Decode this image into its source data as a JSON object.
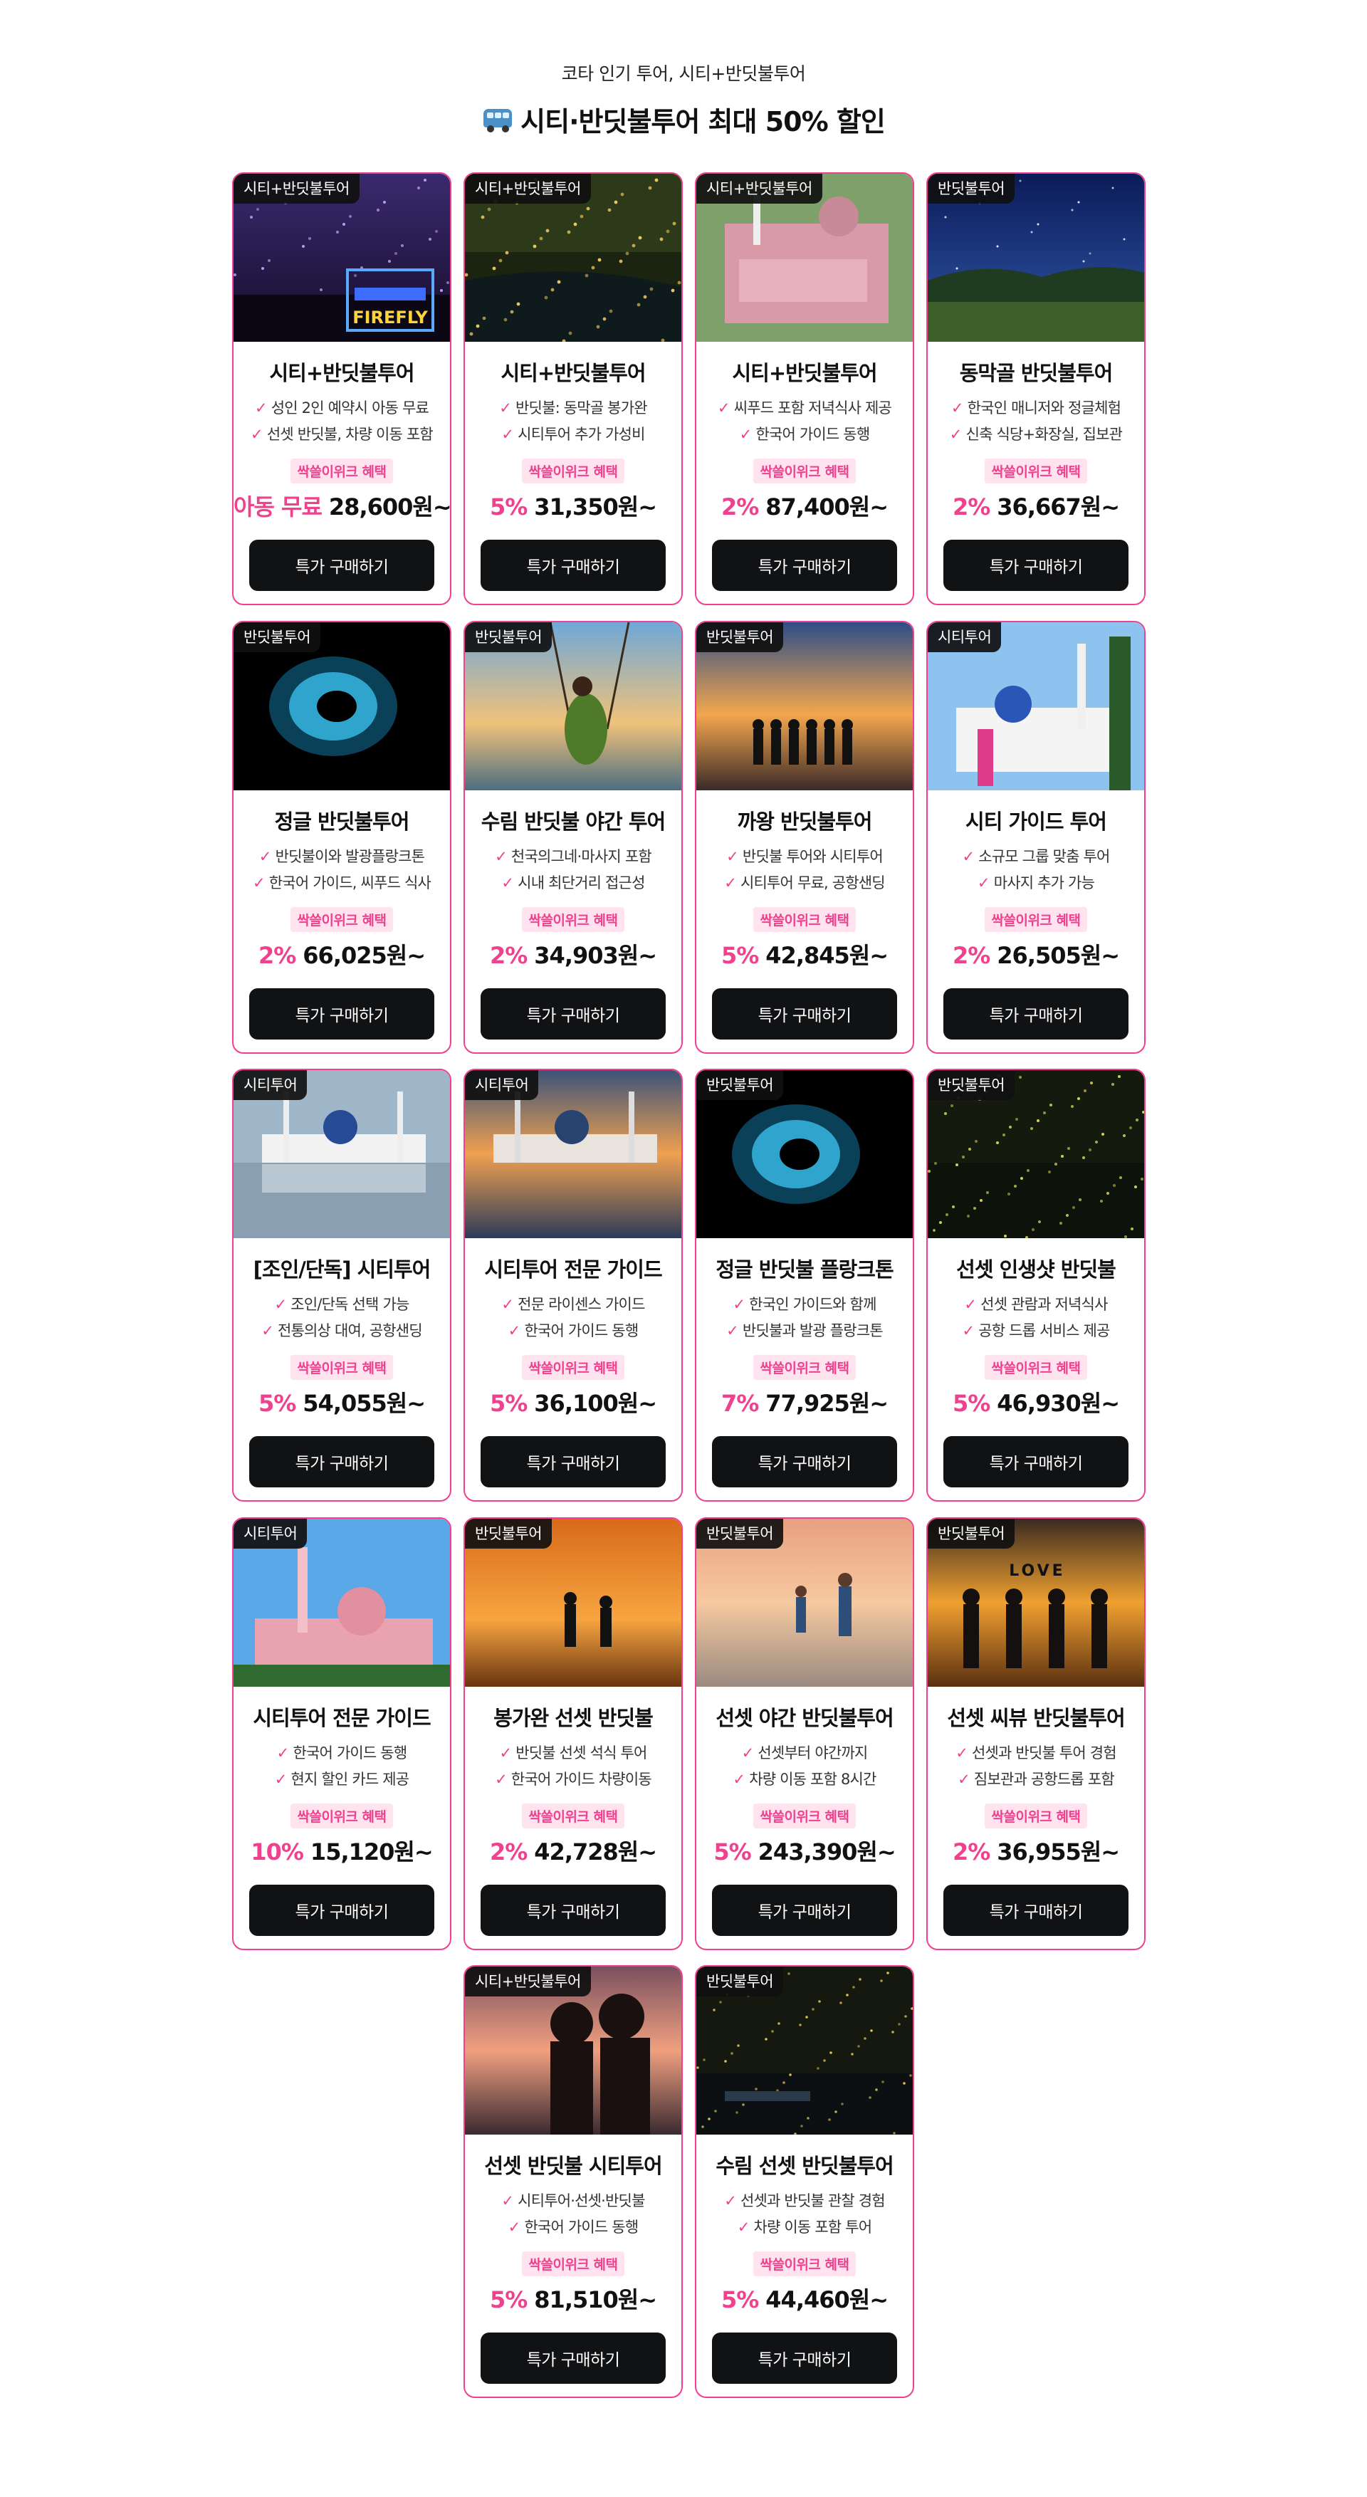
{
  "header": {
    "subtitle": "코타 인기 투어, 시티+반딧불투어",
    "title": "시티·반딧불투어 최대 50% 할인",
    "title_icon": "bus-icon"
  },
  "colors": {
    "accent": "#f0418f",
    "button": "#111214",
    "badge_bg": "#ffe3ef"
  },
  "cards": [
    {
      "tag": "시티+반딧불투어",
      "title": "시티+반딧불투어",
      "features": [
        "성인 2인 예약시 아동 무료",
        "선셋 반딧불, 차량 이동 포함"
      ],
      "badge": "싹쓸이위크 혜택",
      "discount": "아동 무료",
      "price": "28,600원~",
      "button": "특가 구매하기",
      "scene": "firefly-sign"
    },
    {
      "tag": "시티+반딧불투어",
      "title": "시티+반딧불투어",
      "features": [
        "반딧불: 동막골 봉가완",
        "시티투어 추가 가성비"
      ],
      "badge": "싹쓸이위크 혜택",
      "discount": "5%",
      "price": "31,350원~",
      "button": "특가 구매하기",
      "scene": "firefly-river"
    },
    {
      "tag": "시티+반딧불투어",
      "title": "시티+반딧불투어",
      "features": [
        "씨푸드 포함 저녁식사 제공",
        "한국어 가이드 동행"
      ],
      "badge": "싹쓸이위크 혜택",
      "discount": "2%",
      "price": "87,400원~",
      "button": "특가 구매하기",
      "scene": "pink-mosque-aerial"
    },
    {
      "tag": "반딧불투어",
      "title": "동막골 반딧불투어",
      "features": [
        "한국인 매니저와 정글체험",
        "신축 식당+화장실, 집보관"
      ],
      "badge": "싹쓸이위크 혜택",
      "discount": "2%",
      "price": "36,667원~",
      "button": "특가 구매하기",
      "scene": "night-field"
    },
    {
      "tag": "반딧불투어",
      "title": "정글 반딧불투어",
      "features": [
        "반딧불이와 발광플랑크톤",
        "한국어 가이드, 씨푸드 식사"
      ],
      "badge": "싹쓸이위크 혜택",
      "discount": "2%",
      "price": "66,025원~",
      "button": "특가 구매하기",
      "scene": "plankton"
    },
    {
      "tag": "반딧불투어",
      "title": "수림 반딧불 야간 투어",
      "features": [
        "천국의그네·마사지 포함",
        "시내 최단거리 접근성"
      ],
      "badge": "싹쓸이위크 혜택",
      "discount": "2%",
      "price": "34,903원~",
      "button": "특가 구매하기",
      "scene": "swing"
    },
    {
      "tag": "반딧불투어",
      "title": "까왕 반딧불투어",
      "features": [
        "반딧불 투어와 시티투어",
        "시티투어 무료, 공항샌딩"
      ],
      "badge": "싹쓸이위크 혜택",
      "discount": "5%",
      "price": "42,845원~",
      "button": "특가 구매하기",
      "scene": "sunset-group"
    },
    {
      "tag": "시티투어",
      "title": "시티 가이드 투어",
      "features": [
        "소규모 그룹 맞춤 투어",
        "마사지 추가 가능"
      ],
      "badge": "싹쓸이위크 혜택",
      "discount": "2%",
      "price": "26,505원~",
      "button": "특가 구매하기",
      "scene": "city-mosque"
    },
    {
      "tag": "시티투어",
      "title": "[조인/단독] 시티투어",
      "features": [
        "조인/단독 선택 가능",
        "전통의상 대여, 공항샌딩"
      ],
      "badge": "싹쓸이위크 혜택",
      "discount": "5%",
      "price": "54,055원~",
      "button": "특가 구매하기",
      "scene": "floating-mosque"
    },
    {
      "tag": "시티투어",
      "title": "시티투어 전문 가이드",
      "features": [
        "전문 라이센스 가이드",
        "한국어 가이드 동행"
      ],
      "badge": "싹쓸이위크 혜택",
      "discount": "5%",
      "price": "36,100원~",
      "button": "특가 구매하기",
      "scene": "floating-mosque-sunset"
    },
    {
      "tag": "반딧불투어",
      "title": "정글 반딧불 플랑크톤",
      "features": [
        "한국인 가이드와 함께",
        "반딧불과 발광 플랑크톤"
      ],
      "badge": "싹쓸이위크 혜택",
      "discount": "7%",
      "price": "77,925원~",
      "button": "특가 구매하기",
      "scene": "plankton"
    },
    {
      "tag": "반딧불투어",
      "title": "선셋 인생샷 반딧불",
      "features": [
        "선셋 관람과 저녁식사",
        "공항 드롭 서비스 제공"
      ],
      "badge": "싹쓸이위크 혜택",
      "discount": "5%",
      "price": "46,930원~",
      "button": "특가 구매하기",
      "scene": "fireflies-dark"
    },
    {
      "tag": "시티투어",
      "title": "시티투어 전문 가이드",
      "features": [
        "한국어 가이드 동행",
        "현지 할인 카드 제공"
      ],
      "badge": "싹쓸이위크 혜택",
      "discount": "10%",
      "price": "15,120원~",
      "button": "특가 구매하기",
      "scene": "pink-mosque"
    },
    {
      "tag": "반딧불투어",
      "title": "봉가완 선셋 반딧불",
      "features": [
        "반딧불 선셋 석식 투어",
        "한국어 가이드 차량이동"
      ],
      "badge": "싹쓸이위크 혜택",
      "discount": "2%",
      "price": "42,728원~",
      "button": "특가 구매하기",
      "scene": "sunset-couple"
    },
    {
      "tag": "반딧불투어",
      "title": "선셋 야간 반딧불투어",
      "features": [
        "선셋부터 야간까지",
        "차량 이동 포함 8시간"
      ],
      "badge": "싹쓸이위크 혜택",
      "discount": "5%",
      "price": "243,390원~",
      "button": "특가 구매하기",
      "scene": "beach-family"
    },
    {
      "tag": "반딧불투어",
      "title": "선셋 씨뷰 반딧불투어",
      "features": [
        "선셋과 반딧불 투어 경험",
        "짐보관과 공항드롭 포함"
      ],
      "badge": "싹쓸이위크 혜택",
      "discount": "2%",
      "price": "36,955원~",
      "button": "특가 구매하기",
      "scene": "love-family",
      "scene_text": "LOVE"
    },
    {
      "tag": "시티+반딧불투어",
      "title": "선셋 반딧불 시티투어",
      "features": [
        "시티투어·선셋·반딧불",
        "한국어 가이드 동행"
      ],
      "badge": "싹쓸이위크 혜택",
      "discount": "5%",
      "price": "81,510원~",
      "button": "특가 구매하기",
      "scene": "kiss-sunset"
    },
    {
      "tag": "반딧불투어",
      "title": "수림 선셋 반딧불투어",
      "features": [
        "선셋과 반딧불 관찰 경험",
        "차량 이동 포함 투어"
      ],
      "badge": "싹쓸이위크 혜택",
      "discount": "5%",
      "price": "44,460원~",
      "button": "특가 구매하기",
      "scene": "boat-fireflies"
    }
  ]
}
